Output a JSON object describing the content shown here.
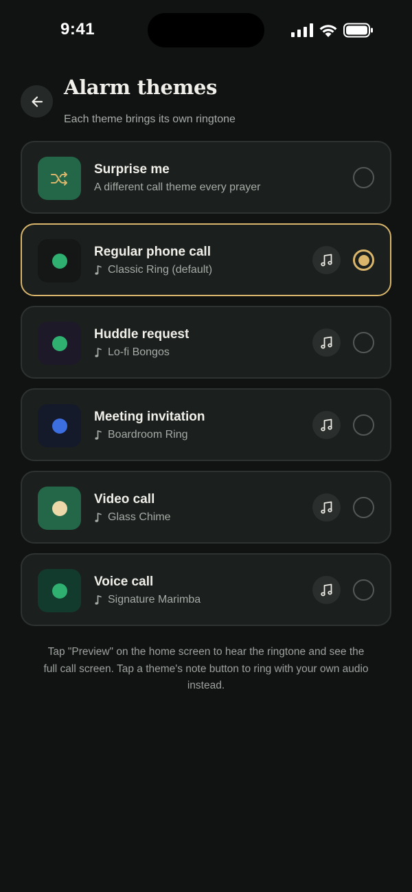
{
  "status_bar": {
    "time": "9:41"
  },
  "header": {
    "title": "Alarm themes",
    "subtitle": "Each theme brings its own ringtone"
  },
  "colors": {
    "background": "#101312",
    "card": "#1b1f1d",
    "accent_gold": "#d9b66c",
    "green": "#2fb071",
    "blue": "#3d6ee0",
    "cream": "#ecd8a8"
  },
  "themes": [
    {
      "name": "Surprise me",
      "subtitle": "A different call theme every prayer",
      "icon": "shuffle-icon",
      "icon_bg": "#236648",
      "selected": false
    },
    {
      "name": "Regular phone call",
      "subtitle": "Classic Ring (default)",
      "icon": "green-dot",
      "icon_bg": "#141716",
      "dot": "#2fb071",
      "selected": true
    },
    {
      "name": "Huddle request",
      "subtitle": "Lo-fi Bongos",
      "icon": "green-dot",
      "icon_bg": "#1d1928",
      "dot": "#2fb071",
      "selected": false
    },
    {
      "name": "Meeting invitation",
      "subtitle": "Boardroom Ring",
      "icon": "blue-dot",
      "icon_bg": "#141a29",
      "dot": "#3d6ee0",
      "selected": false
    },
    {
      "name": "Video call",
      "subtitle": "Glass Chime",
      "icon": "cream-dot",
      "icon_bg": "#236648",
      "dot": "#ecd8a8",
      "selected": false
    },
    {
      "name": "Voice call",
      "subtitle": "Signature Marimba",
      "icon": "green-dot",
      "icon_bg": "#133b2d",
      "dot": "#2fb071",
      "selected": false
    }
  ],
  "footer": {
    "note": "Tap \"Preview\" on the home screen to hear the ringtone and see the full call screen. Tap a theme's note button to ring with your own audio instead."
  }
}
